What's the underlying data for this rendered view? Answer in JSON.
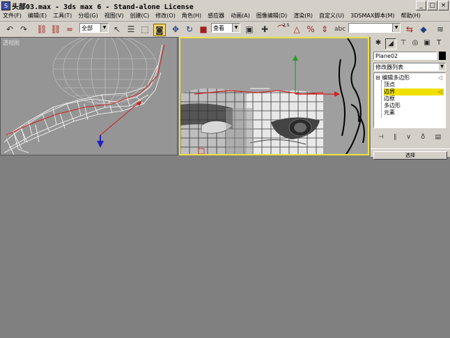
{
  "window": {
    "title": "头部03.max - 3ds max 6 - Stand-alone License",
    "app_icon": "3ds-max-icon",
    "controls": [
      "_",
      "□",
      "×"
    ]
  },
  "menubar": {
    "items": [
      "文件(F)",
      "编辑(E)",
      "工具(T)",
      "分组(G)",
      "视图(V)",
      "创建(C)",
      "修改(O)",
      "角色(H)",
      "感应器",
      "动画(A)",
      "图像编辑(D)",
      "渲染(R)",
      "自定义(U)",
      "3DSMAX脚本(M)",
      "帮助(H)"
    ]
  },
  "toolbar": {
    "selection_filter": "全部",
    "reference_coord": "查看",
    "named_selection": "",
    "snap_label": "2.5",
    "angle_snap_label": "%"
  },
  "viewports": {
    "left_label": "透视图"
  },
  "command_panel": {
    "object_name": "Plane02",
    "object_color": "#000000",
    "modifier_list": "修改器列表",
    "stack": {
      "root": "编辑多边形",
      "items": [
        "顶点",
        "边界",
        "边框",
        "多边形",
        "元素"
      ],
      "selected_index": 1
    },
    "rollout": "选择"
  },
  "colors": {
    "active_viewport_border": "#f0e040",
    "selected_stack_item": "#f0e000",
    "ui_gray": "#d4d0c8"
  }
}
